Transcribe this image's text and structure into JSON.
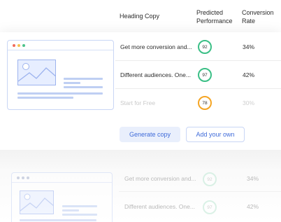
{
  "header": {
    "heading_copy": "Heading Copy",
    "predicted_line1": "Predicted",
    "predicted_line2": "Performance",
    "conversion_line1": "Conversion",
    "conversion_line2": "Rate"
  },
  "rows": [
    {
      "copy": "Get more conversion and...",
      "score": "92",
      "score_color": "#3bbf86",
      "rate": "34%"
    },
    {
      "copy": "Different audiences. One...",
      "score": "97",
      "score_color": "#3bbf86",
      "rate": "42%"
    },
    {
      "copy": "Start for Free",
      "score": "78",
      "score_color": "#f5a524",
      "rate": "30%"
    }
  ],
  "actions": {
    "generate": "Generate copy",
    "add_own": "Add your own"
  },
  "ghost_rows": [
    {
      "copy": "Get more conversion and...",
      "score": "92",
      "rate": "34%"
    },
    {
      "copy": "Different audiences. One...",
      "score": "97",
      "rate": "42%"
    }
  ],
  "colors": {
    "accent": "#3f6bd9",
    "dot_red": "#f26b5b",
    "dot_yellow": "#f5c150",
    "dot_green": "#4cc38a"
  }
}
